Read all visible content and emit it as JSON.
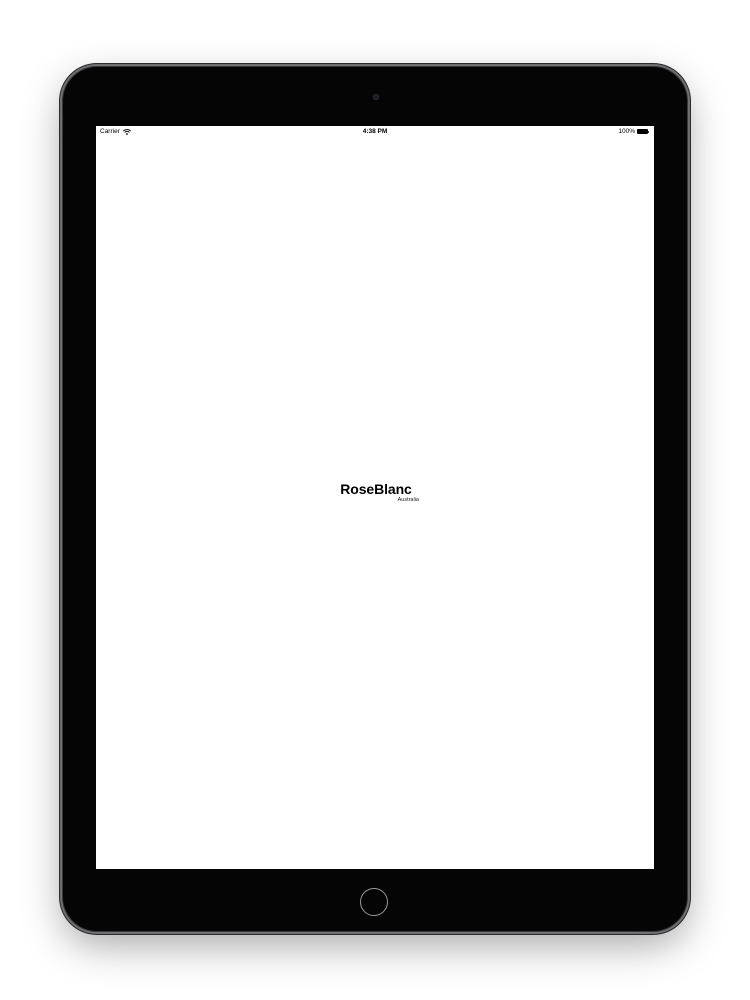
{
  "status_bar": {
    "carrier": "Carrier",
    "time": "4:38 PM",
    "battery": "100%"
  },
  "app": {
    "logo_text": "RoseBlanc",
    "region": "Australia"
  },
  "icons": {
    "wifi": "wifi-icon",
    "battery": "battery-icon",
    "home": "home-button"
  }
}
